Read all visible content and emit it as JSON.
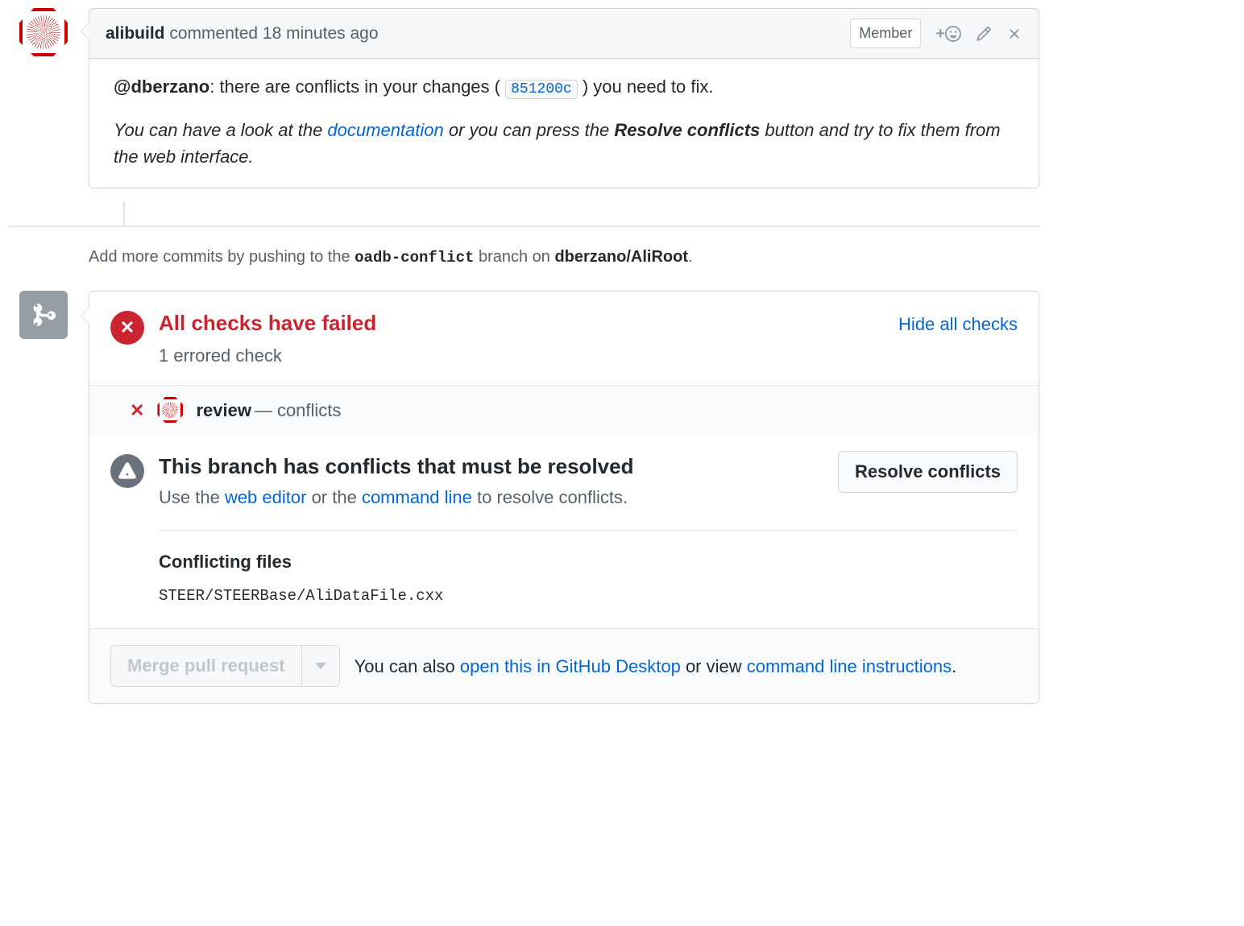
{
  "comment": {
    "author": "alibuild",
    "action": "commented",
    "time": "18 minutes ago",
    "badge": "Member",
    "body": {
      "mention": "@dberzano",
      "line1_a": ": there are conflicts in your changes ( ",
      "commit": "851200c",
      "line1_b": " ) you need to fix.",
      "line2_a": "You can have a look at the ",
      "doc_link": "documentation",
      "line2_b": " or you can press the ",
      "resolve_bold": "Resolve conflicts",
      "line2_c": " button and try to fix them from the web interface."
    }
  },
  "push_hint": {
    "pre": "Add more commits by pushing to the ",
    "branch": "oadb-conflict",
    "mid": " branch on ",
    "repo": "dberzano/AliRoot",
    "post": "."
  },
  "checks": {
    "title": "All checks have failed",
    "subtitle": "1 errored check",
    "hide_link": "Hide all checks",
    "items": [
      {
        "name": "review",
        "status": "— conflicts"
      }
    ]
  },
  "conflict": {
    "title": "This branch has conflicts that must be resolved",
    "sub_pre": "Use the ",
    "web_editor": "web editor",
    "sub_mid": " or the ",
    "command_line": "command line",
    "sub_post": " to resolve conflicts.",
    "resolve_btn": "Resolve conflicts",
    "files_label": "Conflicting files",
    "files": [
      "STEER/STEERBase/AliDataFile.cxx"
    ]
  },
  "footer": {
    "merge_btn": "Merge pull request",
    "text_pre": "You can also ",
    "desktop_link": "open this in GitHub Desktop",
    "text_mid": " or view ",
    "cli_link": "command line instructions",
    "text_post": "."
  }
}
